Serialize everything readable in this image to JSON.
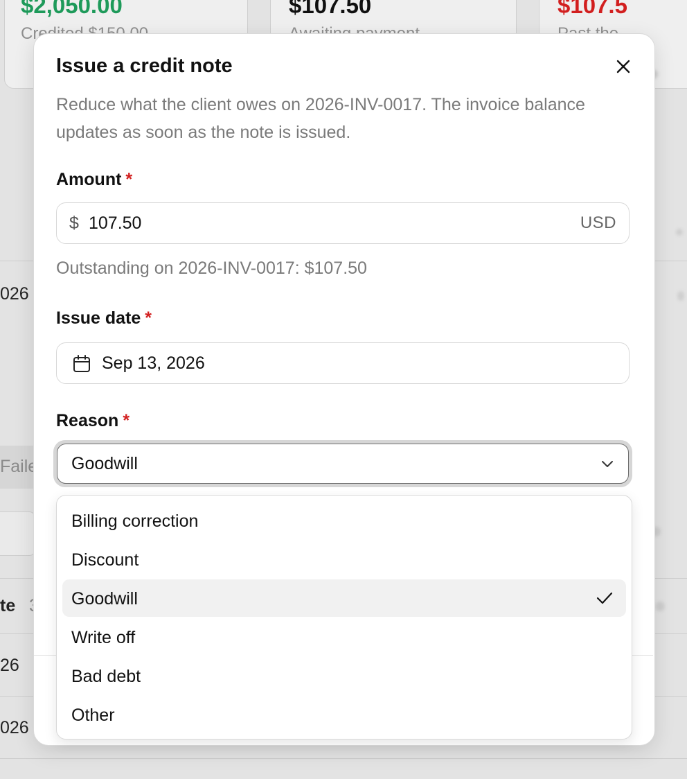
{
  "background": {
    "cards": [
      {
        "amount": "$2,050.00",
        "sub": "Credited $150.00",
        "color": "#1e9a5a"
      },
      {
        "amount": "$107.50",
        "sub": "Awaiting payment",
        "color": "#111111"
      },
      {
        "amount": "$107.5",
        "sub": "Past the",
        "color": "#d21f1f"
      }
    ],
    "fragments": {
      "year_row_1": "026",
      "failed_tab": "Faile",
      "col_header": "te",
      "col_header_num": "3",
      "row_2": "26",
      "row_3": "026"
    }
  },
  "modal": {
    "title": "Issue a credit note",
    "description": "Reduce what the client owes on 2026-INV-0017. The invoice balance updates as soon as the note is issued.",
    "amount": {
      "label": "Amount",
      "required_mark": "*",
      "prefix": "$",
      "value": "107.50",
      "suffix": "USD",
      "hint": "Outstanding on 2026-INV-0017: $107.50"
    },
    "issue_date": {
      "label": "Issue date",
      "required_mark": "*",
      "value": "Sep 13, 2026"
    },
    "reason": {
      "label": "Reason",
      "required_mark": "*",
      "selected": "Goodwill",
      "options": [
        "Billing correction",
        "Discount",
        "Goodwill",
        "Write off",
        "Bad debt",
        "Other"
      ]
    }
  },
  "icons": {
    "close": "close-icon",
    "calendar": "calendar-icon",
    "chevron": "chevron-down-icon",
    "check": "check-icon"
  },
  "colors": {
    "positive": "#1e9a5a",
    "negative": "#d21f1f",
    "required": "#d21f1f",
    "muted_text": "#7a7a7a"
  }
}
